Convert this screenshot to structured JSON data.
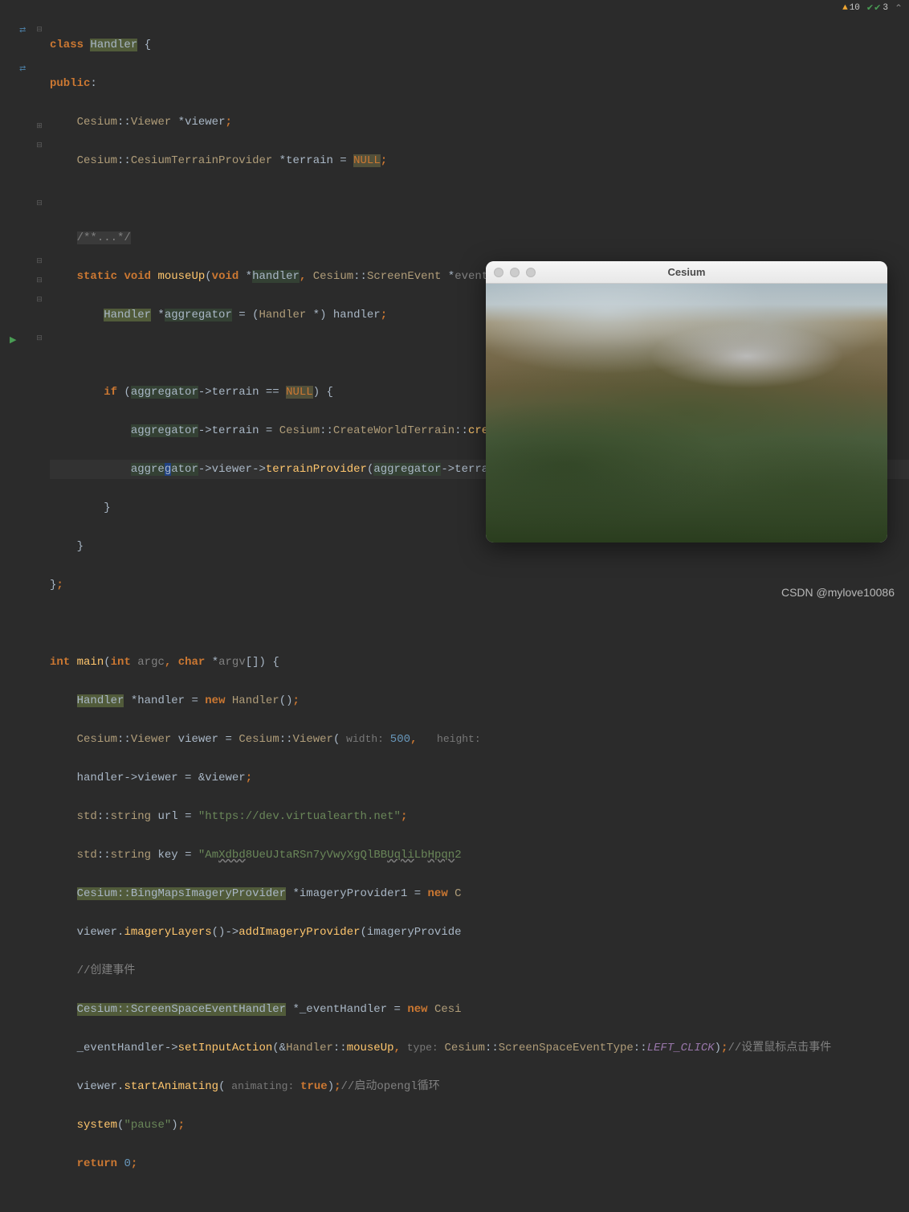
{
  "topbar": {
    "warn_count": "10",
    "check_count": "3"
  },
  "code": {
    "l1_class": "class",
    "l1_handler": "Handler",
    "l1_brace": " {",
    "l2_public": "public",
    "l2_colon": ":",
    "l3_cesium": "Cesium",
    "l3_viewer": "Viewer",
    "l3_star_viewer": " *",
    "l3_vvar": "viewer",
    "l3_semi": ";",
    "l4_cesium": "Cesium",
    "l4_ctp": "CesiumTerrainProvider",
    "l4_star": " *",
    "l4_terrain": "terrain",
    "l4_eq": " = ",
    "l4_null": "NULL",
    "l4_semi": ";",
    "l6_cmt": "/**...*/",
    "l7_static": "static",
    "l7_void": "void",
    "l7_mouseup": "mouseUp",
    "l7_lp": "(",
    "l7_void2": "void",
    "l7_star": " *",
    "l7_handler": "handler",
    "l7_comma": ", ",
    "l7_cesium": "Cesium",
    "l7_se": "ScreenEvent",
    "l7_star2": " *",
    "l7_event": "event",
    "l7_rp": ")",
    "l7_brace": " {",
    "l8_handler": "Handler",
    "l8_star": " *",
    "l8_agg": "aggregator",
    "l8_eq": " = (",
    "l8_handler2": "Handler",
    "l8_cast": " *) ",
    "l8_hvar": "handler",
    "l8_semi": ";",
    "l10_if": "if",
    "l10_lp": " (",
    "l10_agg": "aggregator",
    "l10_arrow": "->",
    "l10_terrain": "terrain",
    "l10_eqeq": " == ",
    "l10_null": "NULL",
    "l10_rp": ")",
    "l10_brace": " {",
    "l11_agg": "aggregator",
    "l11_arrow": "->",
    "l11_terrain": "terrain",
    "l11_eq": " = ",
    "l11_cesium": "Cesium",
    "l11_cwt": "CreateWorldTerrain",
    "l11_cwt2": "createWorldTerrain",
    "l11_call": "()",
    "l11_semi": ";",
    "l12_agg": "aggregator",
    "l12_arrow1": "->",
    "l12_viewer": "viewer",
    "l12_arrow2": "->",
    "l12_tp": "terrainProvider",
    "l12_lp": "(",
    "l12_agg2": "aggregator",
    "l12_arrow3": "->",
    "l12_terrain": "terrain",
    "l12_rp": ")",
    "l12_semi": ";",
    "l13_cb": "}",
    "l14_cb": "}",
    "l15_cb": "}",
    "l15_semi": ";",
    "l17_int": "int",
    "l17_main": "main",
    "l17_lp": "(",
    "l17_int2": "int",
    "l17_argc": "argc",
    "l17_comma": ", ",
    "l17_char": "char",
    "l17_star": " *",
    "l17_argv": "argv",
    "l17_br": "[])",
    "l17_brace": " {",
    "l18_handler": "Handler",
    "l18_star": " *",
    "l18_hvar": "handler",
    "l18_eq": " = ",
    "l18_new": "new",
    "l18_handler2": "Handler",
    "l18_call": "()",
    "l18_semi": ";",
    "l19_cesium": "Cesium",
    "l19_viewer": "Viewer",
    "l19_vvar": "viewer",
    "l19_eq": " = ",
    "l19_cesium2": "Cesium",
    "l19_viewer2": "Viewer",
    "l19_lp": "(",
    "l19_hint_w": " width: ",
    "l19_500": "500",
    "l19_comma": ",",
    "l19_hint_h": " height: ",
    "l20_hvar": "handler",
    "l20_arrow": "->",
    "l20_viewer": "viewer",
    "l20_eq": " = &",
    "l20_vvar": "viewer",
    "l20_semi": ";",
    "l21_std": "std",
    "l21_string": "string",
    "l21_url": "url",
    "l21_eq": " = ",
    "l21_str": "\"https://dev.virtualearth.net\"",
    "l21_semi": ";",
    "l22_std": "std",
    "l22_string": "string",
    "l22_key": "key",
    "l22_eq": " = ",
    "l22_str": "\"AmXdbd8UeUJtaRSn7yVwyXgQlBBUqliLbHpqn2",
    "l23_cesium": "Cesium",
    "l23_bmip": "BingMapsImageryProvider",
    "l23_star": " *",
    "l23_ip1": "imageryProvider1",
    "l23_eq": " = ",
    "l23_new": "new",
    "l23_c": " C",
    "l24_viewer": "viewer",
    "l24_dot": ".",
    "l24_il": "imageryLayers",
    "l24_call": "()",
    "l24_arrow": "->",
    "l24_aip": "addImageryProvider",
    "l24_lp": "(",
    "l24_ip": "imageryProvide",
    "l25_cmt": "//创建事件",
    "l26_cesium": "Cesium",
    "l26_sseh": "ScreenSpaceEventHandler",
    "l26_star": " *",
    "l26_eh": "_eventHandler",
    "l26_eq": " = ",
    "l26_new": "new",
    "l26_cesi": " Cesi",
    "l27_eh": "_eventHandler",
    "l27_arrow": "->",
    "l27_sia": "setInputAction",
    "l27_lp": "(&",
    "l27_handler": "Handler",
    "l27_mouseup": "mouseUp",
    "l27_comma": ",",
    "l27_hint_type": " type: ",
    "l27_cesium": "Cesium",
    "l27_sset": "ScreenSpaceEventType",
    "l27_lc": "LEFT_CLICK",
    "l27_rp": ")",
    "l27_semi": ";",
    "l27_cmt": "//设置鼠标点击事件",
    "l28_viewer": "viewer",
    "l28_dot": ".",
    "l28_sa": "startAnimating",
    "l28_lp": "(",
    "l28_hint": " animating: ",
    "l28_true": "true",
    "l28_rp": ")",
    "l28_semi": ";",
    "l28_cmt": "//启动opengl循环",
    "l29_system": "system",
    "l29_lp": "(",
    "l29_str": "\"pause\"",
    "l29_rp": ")",
    "l29_semi": ";",
    "l30_return": "return",
    "l30_0": "0",
    "l30_semi": ";"
  },
  "window": {
    "title": "Cesium"
  },
  "watermark": "CSDN @mylove10086"
}
